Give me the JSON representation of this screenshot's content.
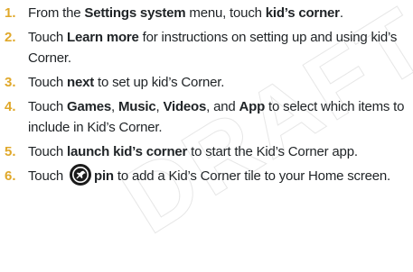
{
  "watermark": {
    "text": "DRAFT"
  },
  "steps": [
    {
      "number": "1.",
      "a": "From the ",
      "b": "Settings system",
      "c": " menu, touch ",
      "d": "kid’s corner",
      "e": "."
    },
    {
      "number": "2.",
      "a": "Touch ",
      "b": "Learn more",
      "c": " for instructions on setting up and using kid’s Corner."
    },
    {
      "number": "3.",
      "a": "Touch ",
      "b": "next",
      "c": " to set up kid’s Corner."
    },
    {
      "number": "4.",
      "a": "Touch ",
      "b": "Games",
      "c": ", ",
      "d": "Music",
      "e": ", ",
      "f": "Videos",
      "g": ", and ",
      "h": "App",
      "i": " to select which items to include in Kid’s Corner."
    },
    {
      "number": "5.",
      "a": "Touch ",
      "b": "launch kid’s corner",
      "c": " to start the Kid’s Corner app."
    },
    {
      "number": "6.",
      "a": "Touch ",
      "icon": "pin-icon",
      "b": "pin",
      "c": " to add a Kid’s Corner tile to your Home screen."
    }
  ]
}
